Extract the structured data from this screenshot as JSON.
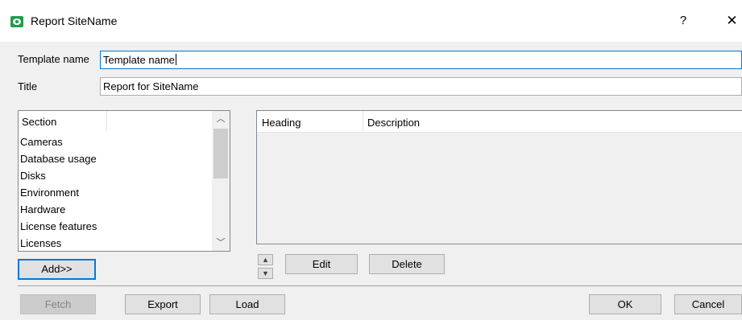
{
  "window": {
    "title": "Report SiteName",
    "help_glyph": "?",
    "close_glyph": "✕"
  },
  "form": {
    "template_name_label": "Template name",
    "template_name_value": "Template name",
    "title_label": "Title",
    "title_value": "Report for SiteName"
  },
  "sections": {
    "header": "Section",
    "items": [
      "Cameras",
      "Database usage",
      "Disks",
      "Environment",
      "Hardware",
      "License features",
      "Licenses"
    ],
    "add_label": "Add>>"
  },
  "items_table": {
    "columns": [
      "Heading",
      "Description"
    ],
    "rows": []
  },
  "controls": {
    "move_up_glyph": "▲",
    "move_down_glyph": "▼",
    "edit_label": "Edit",
    "delete_label": "Delete"
  },
  "footer": {
    "fetch_label": "Fetch",
    "export_label": "Export",
    "load_label": "Load",
    "ok_label": "OK",
    "cancel_label": "Cancel"
  },
  "colors": {
    "accent": "#0078d7",
    "app_icon": "#1f9d4a"
  }
}
